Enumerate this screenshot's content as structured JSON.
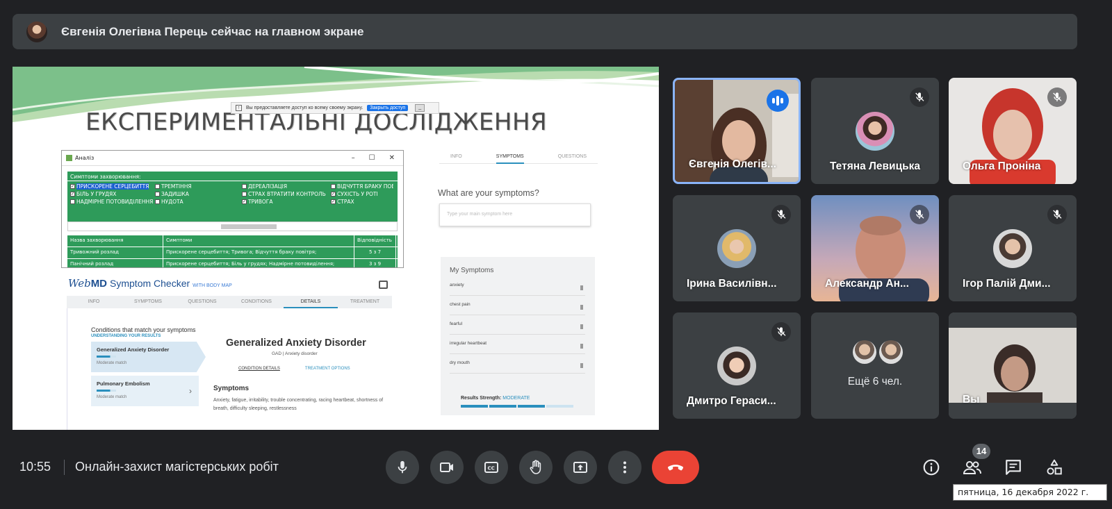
{
  "banner": {
    "text": "Євгенія Олегівна Перець сейчас на главном экране"
  },
  "slide": {
    "title": "ЕКСПЕРИМЕНТАЛЬНІ ДОСЛІДЖЕННЯ",
    "share_notice": "Вы предоставляете доступ ко всему своему экрану.",
    "share_stop": "Закрыть доступ",
    "analysis_window": {
      "title": "Аналіз",
      "symptoms_header": "Симптоми захворювання:",
      "checkboxes": [
        {
          "label": "ПРИСКОРЕНЕ СЕРЦЕБИТТЯ",
          "checked": "✓"
        },
        {
          "label": "ТРЕМТІННЯ",
          "checked": ""
        },
        {
          "label": "ДЕРЕАЛІЗАЦІЯ",
          "checked": ""
        },
        {
          "label": "ВІДЧУТТЯ БРАКУ ПОВІТРЯ",
          "checked": ""
        },
        {
          "label": "БІЛЬ У ГРУДЯХ",
          "checked": "✓"
        },
        {
          "label": "ЗАДИШКА",
          "checked": ""
        },
        {
          "label": "СТРАХ ВТРАТИТИ КОНТРОЛЬ",
          "checked": ""
        },
        {
          "label": "СУХІСТЬ У РОТІ",
          "checked": "✓"
        },
        {
          "label": "НАДМІРНЕ ПОТОВИДІЛЕННЯ",
          "checked": ""
        },
        {
          "label": "НУДОТА",
          "checked": ""
        },
        {
          "label": "ТРИВОГА",
          "checked": "✓"
        },
        {
          "label": "СТРАХ",
          "checked": "✓"
        }
      ],
      "table_headers": [
        "Назва захворювання",
        "Симптоми",
        "Відповідність"
      ],
      "rows": [
        [
          "Тривожний розлад",
          "Прискорене серцебиття; Тривога; Відчуття браку повітря;",
          "5 з 7"
        ],
        [
          "Панічний розлад",
          "Прискорене серцебиття; Біль у грудях; Надмірне потовиділення;",
          "3 з 9"
        ]
      ]
    },
    "webmd": {
      "logo_web": "Web",
      "logo_md": "MD",
      "subtitle": "Symptom Checker",
      "body_map": "WITH BODY MAP",
      "tabs": [
        "INFO",
        "SYMPTOMS",
        "QUESTIONS",
        "CONDITIONS",
        "DETAILS",
        "TREATMENT"
      ],
      "conditions_title": "Conditions that match your symptoms",
      "understanding": "UNDERSTANDING YOUR RESULTS",
      "cards": [
        {
          "name": "Generalized Anxiety Disorder",
          "match": "Moderate match"
        },
        {
          "name": "Pulmonary Embolism",
          "match": "Moderate match"
        }
      ],
      "disorder_title": "Generalized Anxiety Disorder",
      "disorder_sub": "GAD | Anxiety disorder",
      "detail_tabs": [
        "CONDITION DETAILS",
        "TREATMENT OPTIONS"
      ],
      "symptoms_heading": "Symptoms",
      "symptoms_text": "Anxiety, fatigue, irritability, trouble concentrating, racing heartbeat, shortness of breath, difficulty sleeping, restlessness"
    },
    "symptom_panel": {
      "tabs": [
        "INFO",
        "SYMPTOMS",
        "QUESTIONS"
      ],
      "question": "What are your symptoms?",
      "input_placeholder": "Type your main symptom here",
      "my_symptoms_title": "My Symptoms",
      "items": [
        "anxiety",
        "chest pain",
        "fearful",
        "irregular heartbeat",
        "dry mouth"
      ],
      "strength_label": "Results Strength:",
      "strength_value": "MODERATE",
      "strength_level": 0.75
    }
  },
  "participants": [
    {
      "name": "Євгенія Олегів...",
      "state": "speaking"
    },
    {
      "name": "Тетяна Левицька",
      "state": "muted"
    },
    {
      "name": "Ольга Проніна",
      "state": "muted"
    },
    {
      "name": "Ірина Василівн...",
      "state": "muted"
    },
    {
      "name": "Александр Ан...",
      "state": "muted"
    },
    {
      "name": "Ігор Палій Дми...",
      "state": "muted"
    },
    {
      "name": "Дмитро Гераси...",
      "state": "muted"
    },
    {
      "name": "Ещё 6 чел.",
      "state": "more"
    },
    {
      "name": "Вы",
      "state": "self"
    }
  ],
  "bottom_bar": {
    "time": "10:55",
    "meeting_title": "Онлайн-захист магістерських робіт",
    "participant_count": "14",
    "tooltip": "пятница, 16 декабря 2022 г."
  },
  "colors": {
    "background": "#202124",
    "tile": "#3c4043",
    "end_call": "#ea4335",
    "speaking": "#1a73e8",
    "slide_green": "#2e9b5a"
  },
  "icons": {
    "controls": [
      "microphone-icon",
      "camera-icon",
      "captions-icon",
      "raise-hand-icon",
      "present-screen-icon",
      "more-options-icon",
      "end-call-icon"
    ],
    "right": [
      "info-icon",
      "people-icon",
      "chat-icon",
      "activities-icon"
    ]
  }
}
